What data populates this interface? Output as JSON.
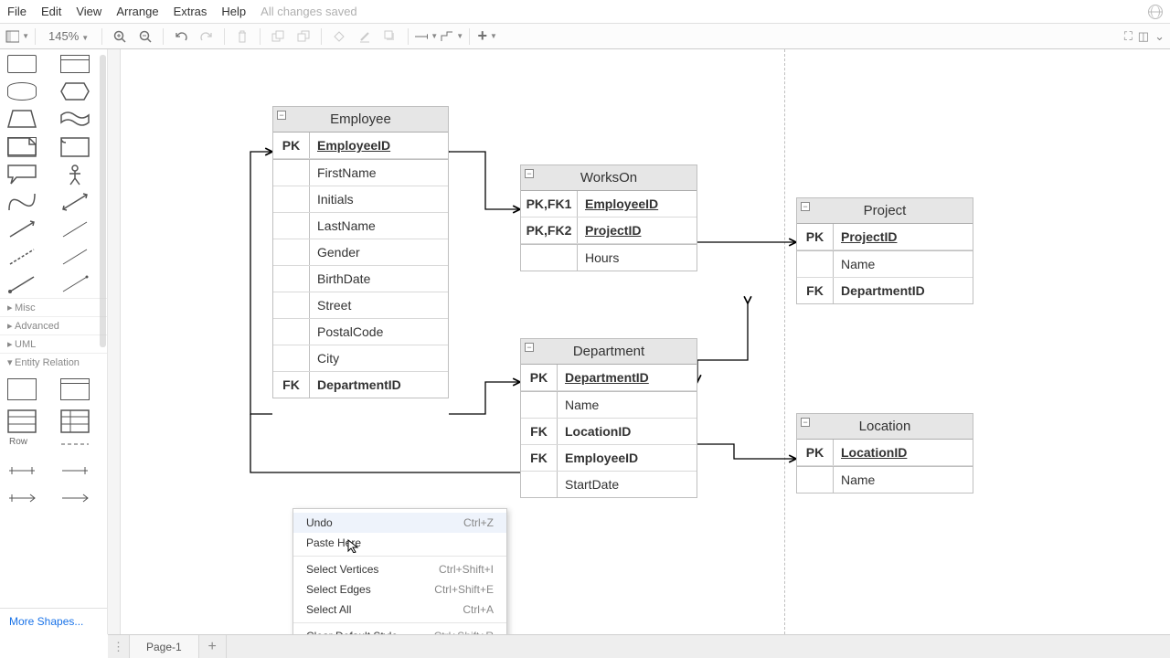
{
  "menu": {
    "file": "File",
    "edit": "Edit",
    "view": "View",
    "arrange": "Arrange",
    "extras": "Extras",
    "help": "Help",
    "saved": "All changes saved"
  },
  "toolbar": {
    "zoom": "145%"
  },
  "sidebar": {
    "categories": [
      {
        "label": "Misc",
        "open": false
      },
      {
        "label": "Advanced",
        "open": false
      },
      {
        "label": "UML",
        "open": false
      },
      {
        "label": "Entity Relation",
        "open": true
      }
    ],
    "more": "More Shapes...",
    "row_label": "Row"
  },
  "entities": {
    "employee": {
      "title": "Employee",
      "rows": [
        {
          "key": "PK",
          "val": "EmployeeID",
          "ul": true,
          "bold": true
        },
        {
          "key": "",
          "val": "FirstName",
          "sep": true
        },
        {
          "key": "",
          "val": "Initials"
        },
        {
          "key": "",
          "val": "LastName"
        },
        {
          "key": "",
          "val": "Gender"
        },
        {
          "key": "",
          "val": "BirthDate"
        },
        {
          "key": "",
          "val": "Street"
        },
        {
          "key": "",
          "val": "PostalCode"
        },
        {
          "key": "",
          "val": "City"
        },
        {
          "key": "FK",
          "val": "DepartmentID",
          "bold": true
        }
      ]
    },
    "workson": {
      "title": "WorksOn",
      "rows": [
        {
          "key": "PK,FK1",
          "val": "EmployeeID",
          "ul": true,
          "bold": true
        },
        {
          "key": "PK,FK2",
          "val": "ProjectID",
          "ul": true,
          "bold": true
        },
        {
          "key": "",
          "val": "Hours",
          "sep": true
        }
      ]
    },
    "project": {
      "title": "Project",
      "rows": [
        {
          "key": "PK",
          "val": "ProjectID",
          "ul": true,
          "bold": true
        },
        {
          "key": "",
          "val": "Name",
          "sep": true
        },
        {
          "key": "FK",
          "val": "DepartmentID",
          "bold": true
        }
      ]
    },
    "department": {
      "title": "Department",
      "rows": [
        {
          "key": "PK",
          "val": "DepartmentID",
          "ul": true,
          "bold": true
        },
        {
          "key": "",
          "val": "Name",
          "sep": true
        },
        {
          "key": "FK",
          "val": "LocationID",
          "bold": true
        },
        {
          "key": "FK",
          "val": "EmployeeID",
          "bold": true
        },
        {
          "key": "",
          "val": "StartDate"
        }
      ]
    },
    "location": {
      "title": "Location",
      "rows": [
        {
          "key": "PK",
          "val": "LocationID",
          "ul": true,
          "bold": true
        },
        {
          "key": "",
          "val": "Name",
          "sep": true
        }
      ]
    }
  },
  "context_menu": {
    "items": [
      {
        "label": "Undo",
        "shortcut": "Ctrl+Z",
        "hover": true
      },
      {
        "label": "Paste Here",
        "shortcut": ""
      },
      {
        "sep": true
      },
      {
        "label": "Select Vertices",
        "shortcut": "Ctrl+Shift+I"
      },
      {
        "label": "Select Edges",
        "shortcut": "Ctrl+Shift+E"
      },
      {
        "label": "Select All",
        "shortcut": "Ctrl+A"
      },
      {
        "sep": true
      },
      {
        "label": "Clear Default Style",
        "shortcut": "Ctrl+Shift+R"
      }
    ]
  },
  "tabs": {
    "page1": "Page-1"
  }
}
